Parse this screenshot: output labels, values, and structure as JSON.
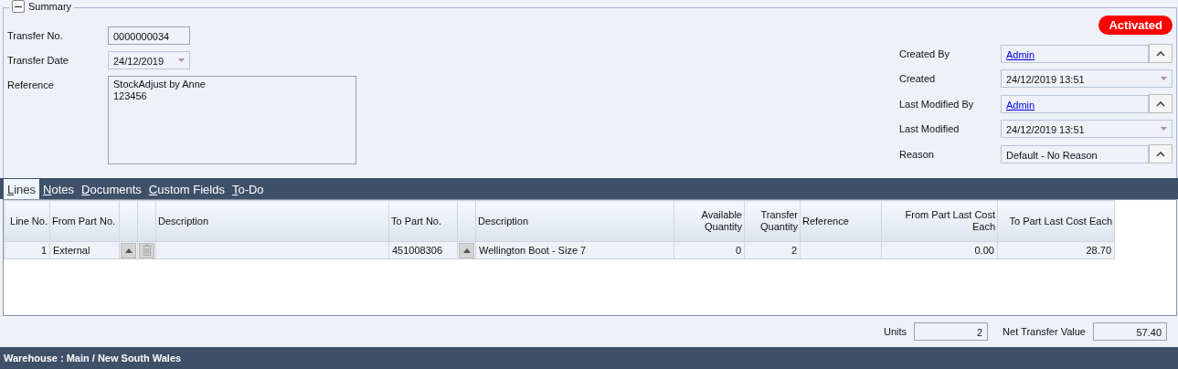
{
  "summary": {
    "title": "Summary",
    "expanded": true,
    "status": "Activated",
    "left_fields": [
      {
        "label": "Transfer No.",
        "kind": "text",
        "value": "0000000034"
      },
      {
        "label": "Transfer Date",
        "kind": "date",
        "value": "24/12/2019"
      },
      {
        "label": "Reference",
        "kind": "memo",
        "lines": [
          "StockAdjust by Anne",
          "123456"
        ]
      }
    ],
    "right_fields": [
      {
        "label": "Created By",
        "kind": "link",
        "value": "Admin"
      },
      {
        "label": "Created",
        "kind": "date",
        "value": "24/12/2019 13:51"
      },
      {
        "label": "Last Modified By",
        "kind": "link",
        "value": "Admin"
      },
      {
        "label": "Last Modified",
        "kind": "date",
        "value": "24/12/2019 13:51"
      },
      {
        "label": "Reason",
        "kind": "combo",
        "value": "Default - No Reason"
      }
    ]
  },
  "tabs": [
    {
      "label": "Lines",
      "selected": true
    },
    {
      "label": "Notes",
      "selected": false
    },
    {
      "label": "Documents",
      "selected": false
    },
    {
      "label": "Custom Fields",
      "selected": false
    },
    {
      "label": "To-Do",
      "selected": false
    }
  ],
  "table": {
    "columns": [
      {
        "kind": "text",
        "label": "Line No."
      },
      {
        "kind": "text",
        "label": "From Part No."
      },
      {
        "kind": "up-button"
      },
      {
        "kind": "delete-button"
      },
      {
        "kind": "text",
        "label": "Description"
      },
      {
        "kind": "text",
        "label": "To Part No."
      },
      {
        "kind": "up-button"
      },
      {
        "kind": "text",
        "label": "Description"
      },
      {
        "kind": "text",
        "label": "Available Quantity"
      },
      {
        "kind": "text",
        "label": "Transfer Quantity"
      },
      {
        "kind": "text",
        "label": "Reference"
      },
      {
        "kind": "text",
        "label": "From Part Last Cost Each"
      },
      {
        "kind": "text",
        "label": "To Part Last Cost Each"
      }
    ],
    "rows": [
      {
        "cells": [
          "1",
          "External",
          null,
          null,
          null,
          "451008306",
          null,
          "Wellington Boot - Size 7",
          "0",
          "2",
          null,
          "0.00",
          "28.70"
        ]
      }
    ]
  },
  "totals": [
    {
      "label": "Units",
      "value": "2"
    },
    {
      "label": "Net Transfer Value",
      "value": "57.40"
    }
  ],
  "status_bar": "Warehouse : Main / New South Wales"
}
